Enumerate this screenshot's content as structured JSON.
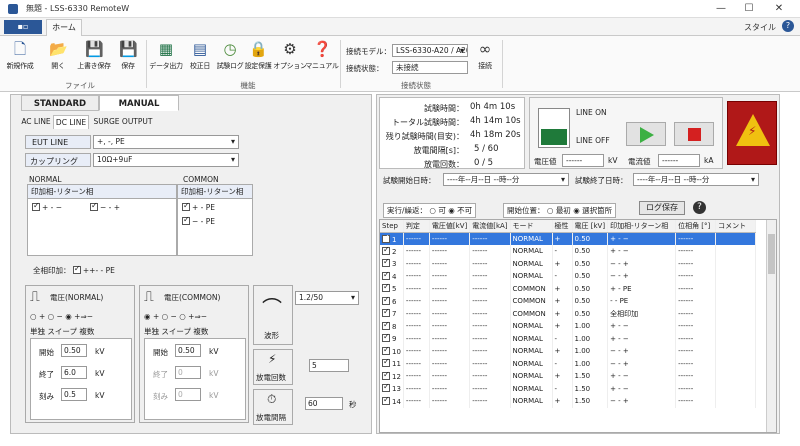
{
  "window": {
    "title": "無題 - LSS-6330 RemoteW",
    "min": "—",
    "max": "☐",
    "close": "✕"
  },
  "ribbon_tabs": {
    "file": "▪▫",
    "home": "ホーム",
    "style": "スタイル",
    "help": "?"
  },
  "file_group": {
    "label": "ファイル",
    "buttons": [
      {
        "label": "新規作成",
        "icon": "new-file-icon"
      },
      {
        "label": "開く",
        "icon": "folder-open-icon"
      },
      {
        "label": "上書き保存",
        "icon": "save-icon"
      },
      {
        "label": "保存",
        "icon": "save-as-icon"
      }
    ]
  },
  "func_group": {
    "label": "機能",
    "buttons": [
      {
        "label": "データ出力",
        "icon": "excel-icon"
      },
      {
        "label": "校正日",
        "icon": "calendar-icon"
      },
      {
        "label": "試験ログ",
        "icon": "log-icon"
      },
      {
        "label": "設定保護",
        "icon": "lock-icon"
      },
      {
        "label": "オプション",
        "icon": "gear-icon"
      },
      {
        "label": "マニュアル",
        "icon": "manual-icon"
      }
    ]
  },
  "conn_group": {
    "label": "接続状態",
    "model_label": "接続モデル：",
    "model_value": "LSS-6330-A20 / A20A",
    "state_label": "接続状態：",
    "state_value": "未接続",
    "connect_label": "接続"
  },
  "left": {
    "tabs": [
      "STANDARD",
      "MANUAL"
    ],
    "subtabs": [
      "AC LINE",
      "DC LINE",
      "SURGE OUTPUT"
    ],
    "eut_line_label": "EUT LINE",
    "eut_line_value": "+, -, PE",
    "coupling_label": "カップリング",
    "coupling_value": "10Ω+9uF",
    "normal_label": "NORMAL",
    "common_label": "COMMON",
    "normal_hdr": "印加相-リターン相",
    "common_hdr": "印加相-リターン相",
    "normal_items": [
      "+ - −",
      "− - +"
    ],
    "common_items": [
      "+ - PE",
      "− - PE"
    ],
    "all_phase_label": "全相印加：",
    "all_phase_value": "++- - PE",
    "v_normal": {
      "title": "電圧(NORMAL)",
      "radios": [
        "+",
        "−",
        "+⇒−"
      ],
      "tabs": [
        "単独",
        "スイープ",
        "複数"
      ],
      "start_label": "開始",
      "start": "0.50",
      "end_label": "終了",
      "end": "6.0",
      "step_label": "刻み",
      "step": "0.5",
      "unit": "kV"
    },
    "v_common": {
      "title": "電圧(COMMON)",
      "radios": [
        "+",
        "−",
        "+⇒−"
      ],
      "tabs": [
        "単独",
        "スイープ",
        "複数"
      ],
      "start_label": "開始",
      "start": "0.50",
      "end_label": "終了",
      "end": "0",
      "step_label": "刻み",
      "step": "0",
      "unit": "kV"
    },
    "waveform": {
      "label": "波形",
      "value": "1.2/50"
    },
    "discharge_count": {
      "label": "放電回数",
      "value": "5"
    },
    "discharge_interval": {
      "label": "放電間隔",
      "value": "60",
      "unit": "秒"
    }
  },
  "right": {
    "status": [
      {
        "label": "試験時間：",
        "value": "0h  4m 10s"
      },
      {
        "label": "トータル試験時間：",
        "value": "4h 14m 10s"
      },
      {
        "label": "残り試験時間(目安)：",
        "value": "4h 18m 20s"
      },
      {
        "label": "放電間隔[s]：",
        "value": "5  /  60"
      },
      {
        "label": "放電回数：",
        "value": "0  /  5"
      }
    ],
    "line_on": "LINE ON",
    "line_off": "LINE OFF",
    "voltage_label": "電圧値",
    "voltage_value": "------",
    "voltage_unit": "kV",
    "current_label": "電流値",
    "current_value": "------",
    "current_unit": "kA",
    "start_date_label": "試験開始日時：",
    "start_date_value": "----年--月--日 --時--分",
    "end_date_label": "試験終了日時：",
    "end_date_value": "----年--月--日 --時--分",
    "repeat_label": "実行/繰返：",
    "repeat_opts": [
      "可",
      "不可"
    ],
    "start_pos_label": "開始位置：",
    "start_pos_opts": [
      "最初",
      "選択箇所"
    ],
    "log_save": "ログ保存",
    "columns": [
      "Step",
      "判定",
      "電圧値[kV]",
      "電流値[kA]",
      "モード",
      "極性",
      "電圧 [kV]",
      "印加相-リターン相",
      "位相角 [°]",
      "コメント"
    ],
    "rows": [
      [
        "1",
        "------",
        "------",
        "------",
        "NORMAL",
        "+",
        "0.50",
        "+ - −",
        "------"
      ],
      [
        "2",
        "------",
        "------",
        "------",
        "NORMAL",
        "-",
        "0.50",
        "+ - −",
        "------"
      ],
      [
        "3",
        "------",
        "------",
        "------",
        "NORMAL",
        "+",
        "0.50",
        "− - +",
        "------"
      ],
      [
        "4",
        "------",
        "------",
        "------",
        "NORMAL",
        "-",
        "0.50",
        "− - +",
        "------"
      ],
      [
        "5",
        "------",
        "------",
        "------",
        "COMMON",
        "+",
        "0.50",
        "+ - PE",
        "------"
      ],
      [
        "6",
        "------",
        "------",
        "------",
        "COMMON",
        "+",
        "0.50",
        "- - PE",
        "------"
      ],
      [
        "7",
        "------",
        "------",
        "------",
        "COMMON",
        "+",
        "0.50",
        "全相印加",
        "------"
      ],
      [
        "8",
        "------",
        "------",
        "------",
        "NORMAL",
        "+",
        "1.00",
        "+ - −",
        "------"
      ],
      [
        "9",
        "------",
        "------",
        "------",
        "NORMAL",
        "-",
        "1.00",
        "+ - −",
        "------"
      ],
      [
        "10",
        "------",
        "------",
        "------",
        "NORMAL",
        "+",
        "1.00",
        "− - +",
        "------"
      ],
      [
        "11",
        "------",
        "------",
        "------",
        "NORMAL",
        "-",
        "1.00",
        "− - +",
        "------"
      ],
      [
        "12",
        "------",
        "------",
        "------",
        "NORMAL",
        "+",
        "1.50",
        "+ - −",
        "------"
      ],
      [
        "13",
        "------",
        "------",
        "------",
        "NORMAL",
        "-",
        "1.50",
        "+ - −",
        "------"
      ],
      [
        "14",
        "------",
        "------",
        "------",
        "NORMAL",
        "+",
        "1.50",
        "− - +",
        "------"
      ]
    ]
  },
  "colors": {
    "accent": "#2b5797",
    "play": "#3cb043",
    "stop": "#d42020",
    "warn_bg": "#b01818",
    "warn_fg": "#f0c010"
  }
}
